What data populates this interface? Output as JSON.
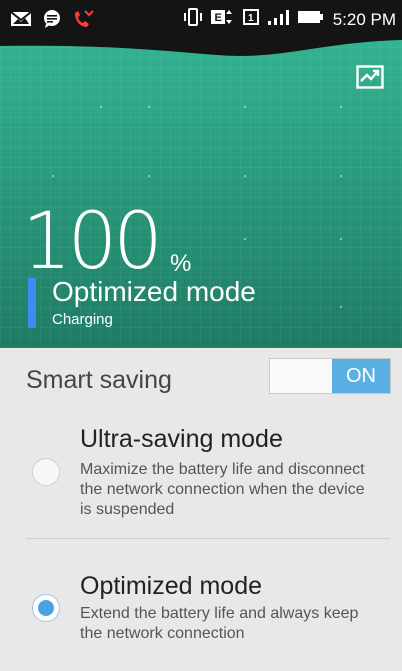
{
  "status_bar": {
    "time": "5:20 PM",
    "icons": [
      "mail-icon",
      "message-icon",
      "missed-call-icon",
      "vibrate-icon",
      "data-e-icon",
      "sim-1-icon",
      "signal-icon",
      "battery-icon"
    ]
  },
  "battery": {
    "percent": "100",
    "percent_sign": "%",
    "mode": "Optimized mode",
    "state": "Charging"
  },
  "smart_saving": {
    "label": "Smart saving",
    "toggle": "ON"
  },
  "options": [
    {
      "title": "Ultra-saving mode",
      "desc": "Maximize the battery life and disconnect the network connection when the device is suspended",
      "selected": false
    },
    {
      "title": "Optimized mode",
      "desc": "Extend the battery life and always keep the network connection",
      "selected": true
    }
  ],
  "colors": {
    "accent": "#4aa3e0",
    "hero": "#2fa88a",
    "mode_bar": "#3b8df0"
  }
}
